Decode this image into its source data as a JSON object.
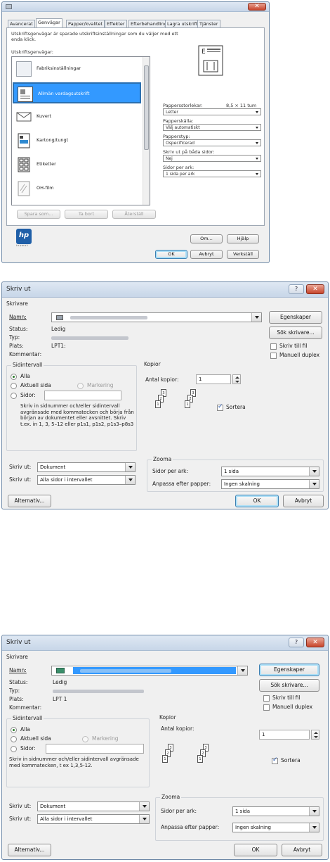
{
  "panel1": {
    "tabs": [
      "Avancerat",
      "Genvägar",
      "Papper/kvalitet",
      "Effekter",
      "Efterbehandling",
      "Lagra utskrift",
      "Tjänster"
    ],
    "description": "Utskriftsgenvägar är sparade utskriftsinställningar som du väljer med ett enda klick.",
    "shortcuts_label": "Utskriftsgenvägar:",
    "shortcuts": [
      "Fabriksinställningar",
      "Allmän vardagsutskrift",
      "Kuvert",
      "Kartong/tungt",
      "Etiketter",
      "OH-film"
    ],
    "paper_size_label": "Pappersstorlekar:",
    "paper_size_dim": "8,5 × 11 tum",
    "paper_size_value": "Letter",
    "paper_source_label": "Papperskälla:",
    "paper_source_value": "Välj automatiskt",
    "paper_type_label": "Papperstyp:",
    "paper_type_value": "Ospecificerad",
    "duplex_label": "Skriv ut på båda sidor:",
    "duplex_value": "Nej",
    "pages_per_sheet_label": "Sidor per ark:",
    "pages_per_sheet_value": "1 sida per ark",
    "save_as_button": "Spara som...",
    "delete_button": "Ta bort",
    "reset_button": "Återställ",
    "logo_text": "hp",
    "logo_subtext": "i n v e n t",
    "about_button": "Om...",
    "help_button": "Hjälp",
    "ok_button": "OK",
    "cancel_button": "Avbryt",
    "apply_button": "Verkställ"
  },
  "dialog1": {
    "title": "Skriv ut",
    "help_glyph": "?",
    "close_glyph": "✕",
    "printer_group": "Skrivare",
    "name_label": "Namn:",
    "properties_button": "Egenskaper",
    "status_label": "Status:",
    "status_value": "Ledig",
    "type_label": "Typ:",
    "where_label": "Plats:",
    "where_value": "LPT1:",
    "comment_label": "Kommentar:",
    "find_printer_button": "Sök skrivare...",
    "print_to_file": "Skriv till fil",
    "manual_duplex": "Manuell duplex",
    "range_group": "Sidintervall",
    "all": "Alla",
    "current_page": "Aktuell sida",
    "selection": "Markering",
    "pages": "Sidor:",
    "help_text": "Skriv in sidnummer och/eller sidintervall avgränsade med kommatecken och börja från början av dokumentet eller avsnittet. Skriv t.ex. in 1, 3, 5–12 eller p1s1, p1s2, p1s3–p8s3",
    "copies_group": "Kopior",
    "copies_label": "Antal kopior:",
    "copies_value": "1",
    "collate": "Sortera",
    "print_what_label": "Skriv ut:",
    "print_what_value": "Dokument",
    "print_label": "Skriv ut:",
    "print_value": "Alla sidor i intervallet",
    "zoom_group": "Zooma",
    "pages_per_sheet_label": "Sidor per ark:",
    "pages_per_sheet_value": "1 sida",
    "scale_label": "Anpassa efter papper:",
    "scale_value": "Ingen skalning",
    "options_button": "Alternativ...",
    "ok_button": "OK",
    "cancel_button": "Avbryt"
  },
  "dialog2": {
    "title": "Skriv ut",
    "help_glyph": "?",
    "close_glyph": "✕",
    "printer_group": "Skrivare",
    "name_label": "Namn:",
    "properties_button": "Egenskaper",
    "status_label": "Status:",
    "status_value": "Ledig",
    "type_label": "Typ:",
    "where_label": "Plats:",
    "where_value": "LPT 1",
    "comment_label": "Kommentar:",
    "find_printer_button": "Sök skrivare...",
    "print_to_file": "Skriv till fil",
    "manual_duplex": "Manuell duplex",
    "range_group": "Sidintervall",
    "all": "Alla",
    "current_page": "Aktuell sida",
    "selection": "Markering",
    "pages": "Sidor:",
    "help_text": "Skriv in sidnummer och/eller sidintervall avgränsade med kommatecken, t ex 1,3,5-12.",
    "copies_group": "Kopior",
    "copies_label": "Antal kopior:",
    "copies_value": "1",
    "collate": "Sortera",
    "print_what_label": "Skriv ut:",
    "print_what_value": "Dokument",
    "print_label": "Skriv ut:",
    "print_value": "Alla sidor i intervallet",
    "zoom_group": "Zooma",
    "pages_per_sheet_label": "Sidor per ark:",
    "pages_per_sheet_value": "1 sida",
    "scale_label": "Anpassa efter papper:",
    "scale_value": "Ingen skalning",
    "options_button": "Alternativ...",
    "ok_button": "OK",
    "cancel_button": "Avbryt"
  },
  "colors": {
    "selection": "#3399ff",
    "focus": "#3c7fb1",
    "close": "#c8452c"
  }
}
